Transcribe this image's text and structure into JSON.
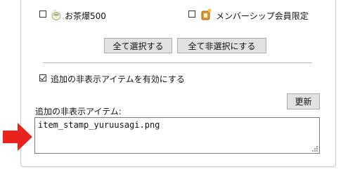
{
  "items": [
    {
      "label": "お茶爆500",
      "checked": false,
      "icon": "tea-cup-icon"
    },
    {
      "label": "メンバーシップ会員限定",
      "checked": false,
      "icon": "membership-badge-icon"
    }
  ],
  "buttons": {
    "select_all": "全て選択する",
    "deselect_all": "全て非選択にする",
    "update": "更新"
  },
  "enable_hidden": {
    "label": "追加の非表示アイテムを有効にする",
    "checked": true
  },
  "hidden_items": {
    "label": "追加の非表示アイテム:",
    "value": "item_stamp_yuruusagi.png"
  },
  "annotation": {
    "icon": "red-arrow-icon",
    "color": "#e8231d"
  }
}
